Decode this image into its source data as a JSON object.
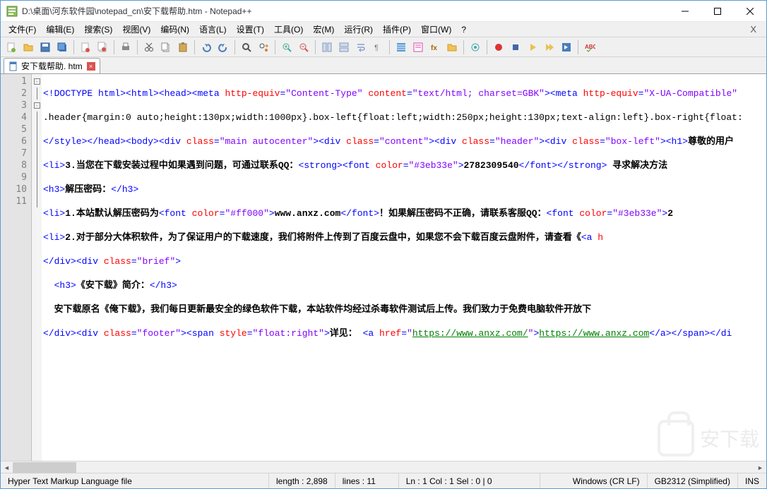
{
  "window": {
    "title": "D:\\桌面\\河东软件园\\notepad_cn\\安下载帮助.htm - Notepad++"
  },
  "menubar": {
    "items": [
      "文件(F)",
      "编辑(E)",
      "搜索(S)",
      "视图(V)",
      "编码(N)",
      "语言(L)",
      "设置(T)",
      "工具(O)",
      "宏(M)",
      "运行(R)",
      "插件(P)",
      "窗口(W)",
      "?"
    ]
  },
  "tab": {
    "label": "安下载帮助. htm"
  },
  "gutter": {
    "lines": [
      "1",
      "2",
      "3",
      "4",
      "5",
      "6",
      "7",
      "8",
      "9",
      "10",
      "11"
    ]
  },
  "code": {
    "l1": {
      "a": "<!DOCTYPE html>",
      "b": "<html>",
      "c": "<head>",
      "d": "<meta ",
      "e": "http-equiv",
      "f": "=",
      "g": "\"Content-Type\"",
      "h": " content",
      "i": "=",
      "j": "\"text/html; charset=GBK\"",
      "k": ">",
      "l": "<meta ",
      "m": "http-equiv",
      "n": "=",
      "o": "\"X-UA-Compatible\""
    },
    "l2": ".header{margin:0 auto;height:130px;width:1000px}.box-left{float:left;width:250px;height:130px;text-align:left}.box-right{float:",
    "l3": {
      "a": "</style>",
      "b": "</head>",
      "c": "<body>",
      "d": "<div ",
      "e": "class",
      "f": "=",
      "g": "\"main autocenter\"",
      "h": ">",
      "i": "<div ",
      "j": "class",
      "k": "=",
      "l": "\"content\"",
      "m": ">",
      "n": "<div ",
      "o": "class",
      "p": "=",
      "q": "\"header\"",
      "r": ">",
      "s": "<div ",
      "t": "class",
      "u": "=",
      "v": "\"box-left\"",
      "w": ">",
      "x": "<h1>",
      "y": "尊敬的用户"
    },
    "l4": {
      "a": "<li>",
      "b": "3.当您在下载安装过程中如果遇到问题，可通过联系QQ：",
      "c": "<strong>",
      "d": "<font ",
      "e": "color",
      "f": "=",
      "g": "\"#3eb33e\"",
      "h": ">",
      "i": "2782309540",
      "j": "</font>",
      "k": "</strong>",
      "l": " 寻求解决方法"
    },
    "l5": {
      "a": "<h3>",
      "b": "解压密码：",
      "c": "</h3>"
    },
    "l6": {
      "a": "<li>",
      "b": "1.本站默认解压密码为",
      "c": "<font ",
      "d": "color",
      "e": "=",
      "f": "\"#ff000\"",
      "g": ">",
      "h": "www.anxz.com",
      "i": "</font>",
      "j": "！如果解压密码不正确，请联系客服QQ：",
      "k": "<font ",
      "l": "color",
      "m": "=",
      "n": "\"#3eb33e\"",
      "o": ">",
      "p": "2"
    },
    "l7": {
      "a": "<li>",
      "b": "2.对于部分大体积软件，为了保证用户的下载速度，我们将附件上传到了百度云盘中，如果您不会下载百度云盘附件，请查看《",
      "c": "<a ",
      "d": "h"
    },
    "l8": {
      "a": "</div>",
      "b": "<div ",
      "c": "class",
      "d": "=",
      "e": "\"brief\"",
      "f": ">"
    },
    "l9": {
      "a": "  <h3>",
      "b": "《安下载》简介：",
      "c": "</h3>"
    },
    "l10": {
      "a": "  ",
      "b": "安下载原名《俺下载》，我们每日更新最安全的绿色软件下载，本站软件均经过杀毒软件测试后上传。我们致力于免费电脑软件开放下"
    },
    "l11": {
      "a": "</div>",
      "b": "<div ",
      "c": "class",
      "d": "=",
      "e": "\"footer\"",
      "f": ">",
      "g": "<span ",
      "h": "style",
      "i": "=",
      "j": "\"float:right\"",
      "k": ">",
      "l": "详见： ",
      "m": "<a ",
      "n": "href",
      "o": "=",
      "p": "\"",
      "q": "https://www.anxz.com/",
      "r": "\"",
      "s": ">",
      "t": "https://www.anxz.com",
      "u": "</a>",
      "v": "</span>",
      "w": "</di"
    }
  },
  "statusbar": {
    "filetype": "Hyper Text Markup Language file",
    "length": "length : 2,898",
    "lines": "lines : 11",
    "pos": "Ln : 1    Col : 1    Sel : 0 | 0",
    "eol": "Windows (CR LF)",
    "enc": "GB2312 (Simplified)",
    "ins": "INS"
  },
  "watermark": "安下载"
}
